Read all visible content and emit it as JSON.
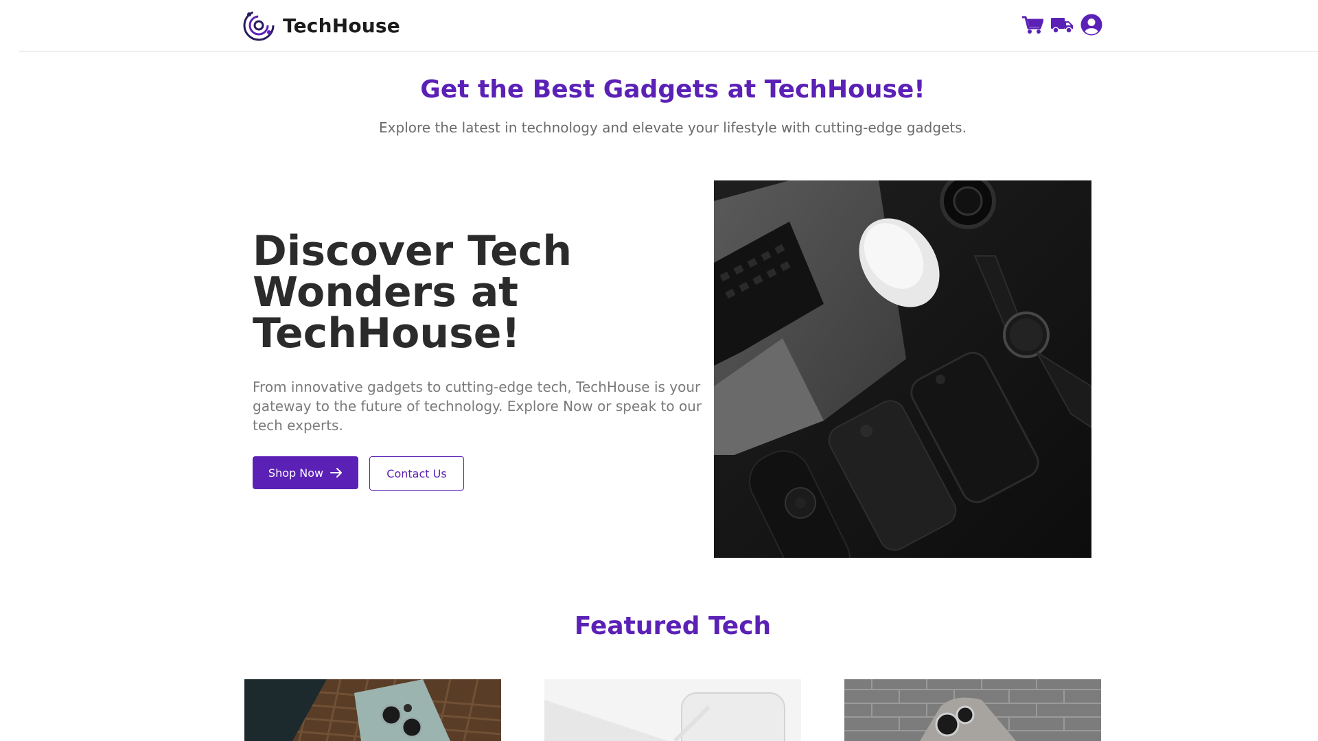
{
  "header": {
    "brand_name": "TechHouse",
    "icons": [
      "logo-icon",
      "cart-icon",
      "delivery-truck-icon",
      "user-account-icon"
    ]
  },
  "intro": {
    "title": "Get the Best Gadgets at TechHouse!",
    "subtitle": "Explore the latest in technology and elevate your lifestyle with cutting-edge gadgets."
  },
  "hero": {
    "title": "Discover Tech Wonders at TechHouse!",
    "description": "From innovative gadgets to cutting-edge tech, TechHouse is your gateway to the future of technology. Explore Now or speak to our tech experts.",
    "primary_button": "Shop Now",
    "secondary_button": "Contact Us"
  },
  "featured": {
    "title": "Featured Tech"
  },
  "colors": {
    "brand_purple": "#5b21b6",
    "heading_dark": "#2b2b2b",
    "body_gray": "#7a7a7a"
  }
}
